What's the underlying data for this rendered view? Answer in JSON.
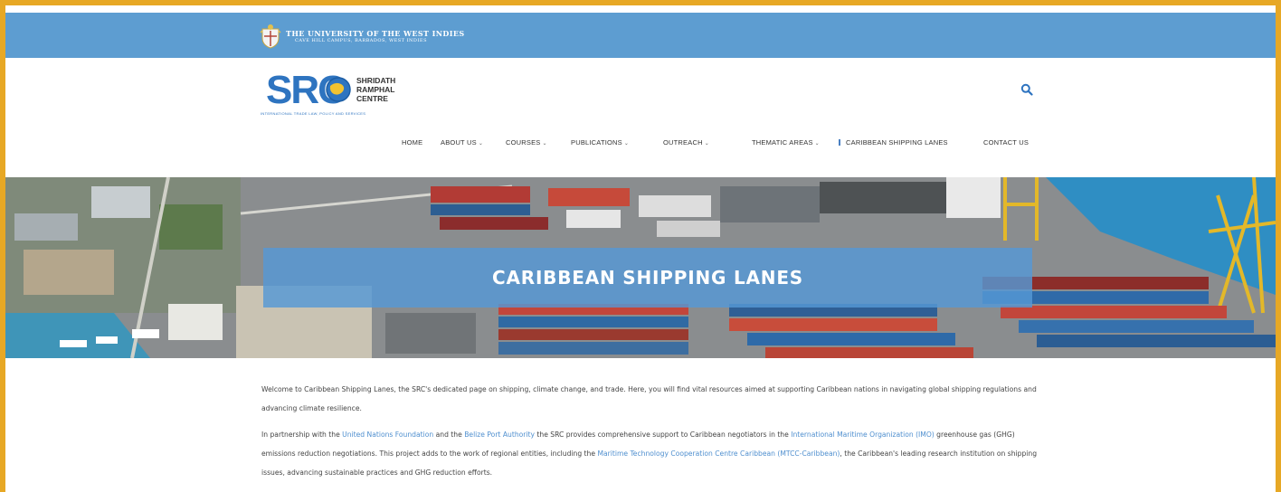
{
  "university": {
    "name": "THE UNIVERSITY OF THE WEST INDIES",
    "campus": "CAVE HILL CAMPUS, BARBADOS, WEST INDIES"
  },
  "logo": {
    "acronym": "SRC",
    "name_line1": "SHRIDATH",
    "name_line2": "RAMPHAL",
    "name_line3": "CENTRE",
    "tagline": "INTERNATIONAL TRADE LAW, POLICY AND SERVICES"
  },
  "header": {
    "search_icon": "search-icon"
  },
  "nav": {
    "items": [
      {
        "label": "HOME"
      },
      {
        "label": "ABOUT US"
      },
      {
        "label": "COURSES"
      },
      {
        "label": "PUBLICATIONS"
      },
      {
        "label": "OUTREACH"
      },
      {
        "label": "THEMATIC AREAS"
      },
      {
        "label": "CARIBBEAN SHIPPING LANES"
      },
      {
        "label": "CONTACT US"
      }
    ],
    "caret": "⌄"
  },
  "hero": {
    "title": "CARIBBEAN SHIPPING LANES"
  },
  "content": {
    "p1": "Welcome to Caribbean Shipping Lanes, the SRC's dedicated page on shipping, climate change, and trade. Here, you will find vital resources aimed at supporting Caribbean nations in navigating global shipping regulations and advancing climate resilience.",
    "p2_a": "In partnership with the ",
    "p2_link1": "United Nations Foundation",
    "p2_b": " and the ",
    "p2_link2": "Belize Port Authority",
    "p2_c": " the SRC provides comprehensive support to Caribbean negotiators in the ",
    "p2_link3": "International Maritime Organization (IMO)",
    "p2_d": " greenhouse gas (GHG) emissions reduction negotiations. This project adds to the work of regional entities, including the ",
    "p2_link4": "Maritime Technology Cooperation Centre Caribbean (MTCC-Caribbean)",
    "p2_e": ", the Caribbean's leading research institution on shipping issues, advancing sustainable practices and GHG reduction efforts."
  },
  "colors": {
    "topbar": "#5d9dd1",
    "brand_blue": "#2e74c0",
    "frame": "#e7a825",
    "link": "#4f8fcf"
  }
}
